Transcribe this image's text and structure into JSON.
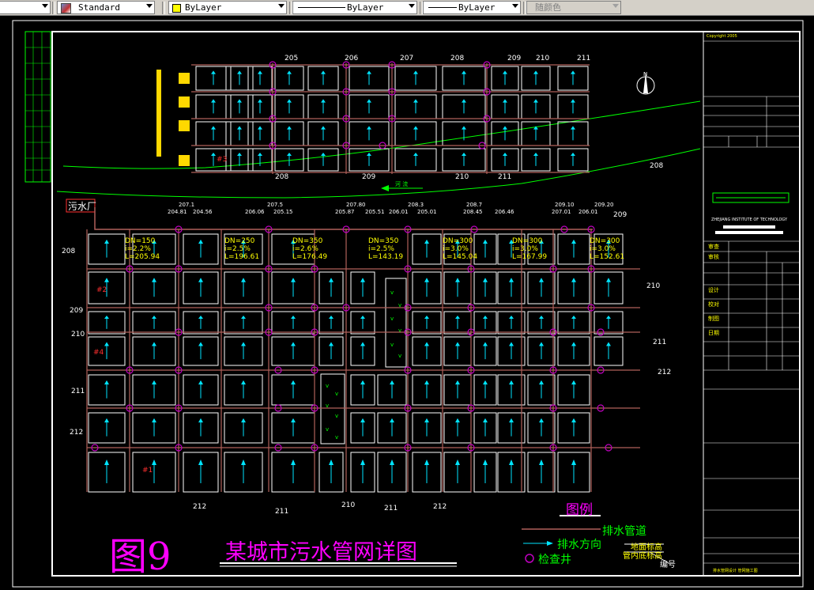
{
  "toolbar": {
    "text_style": "Standard",
    "layer_color": "ByLayer",
    "linetype": "ByLayer",
    "lineweight": "ByLayer",
    "plot_style": "随颜色"
  },
  "drawing": {
    "figure_number": "图9",
    "title": "某城市污水管网详图",
    "plant_label": "污水厂",
    "river_label": "河 流",
    "legend_title": "图例",
    "legend_items": {
      "pipe": "排水管道",
      "direction": "排水方向",
      "manhole": "检查井",
      "ground_elev": "地面标高",
      "invert_elev": "管内底标高",
      "number": "编号"
    },
    "block_labels": [
      "#3",
      "#2",
      "#4",
      "#1"
    ],
    "top_numbers": [
      "205",
      "206",
      "207",
      "208",
      "209",
      "210",
      "211"
    ],
    "top_bottom_numbers": [
      "208",
      "209",
      "210",
      "211"
    ],
    "left_numbers": [
      "208",
      "209",
      "210",
      "211",
      "212"
    ],
    "right_numbers": [
      "208",
      "209",
      "210",
      "211",
      "212"
    ],
    "bottom_numbers": [
      "212",
      "211",
      "210",
      "211",
      "212"
    ],
    "pipe_specs": [
      {
        "dn": "DN=150",
        "slope": "i=2.2%",
        "len": "L=205.94"
      },
      {
        "dn": "DN=250",
        "slope": "i=2.5%",
        "len": "L=196.61"
      },
      {
        "dn": "DN=350",
        "slope": "i=2.6%",
        "len": "L=176.49"
      },
      {
        "dn": "DN=350",
        "slope": "i=2.5%",
        "len": "L=143.19"
      },
      {
        "dn": "DN=300",
        "slope": "i=3.0%",
        "len": "L=145.04"
      },
      {
        "dn": "DN=300",
        "slope": "i=3.0%",
        "len": "L=167.99"
      },
      {
        "dn": "DN=300",
        "slope": "i=3.0%",
        "len": "L=152.61"
      }
    ],
    "manhole_tags": [
      "207.1",
      "207.5",
      "207.80",
      "208.3",
      "208.7",
      "209.10",
      "209.20"
    ],
    "elevations": [
      "204.81",
      "204.56",
      "206.06",
      "205.15",
      "205.87",
      "205.51",
      "206.01",
      "205.01",
      "208.45",
      "206.46",
      "207.01",
      "206.01"
    ],
    "title_block": {
      "copyright": "Copyright 2005",
      "institute": "ZHEJIANG INSTITUTE OF TECHNOLOGY",
      "rows": [
        "审查",
        "审核",
        "设计",
        "校对",
        "制图",
        "日期"
      ],
      "footer": "排水管网设计 管网施工图"
    },
    "colors": {
      "frame": "#ffffff",
      "block": "#ffffff",
      "pipe": "#b0605a",
      "arrow": "#00e5ff",
      "manhole": "#c000c0",
      "river": "#00ff00",
      "title": "#ff00ff",
      "tag": "#ffff00"
    }
  }
}
